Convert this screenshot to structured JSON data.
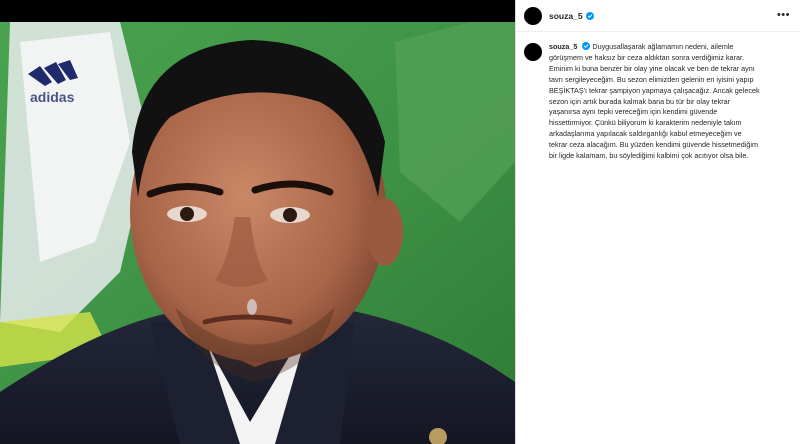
{
  "post": {
    "username": "souza_5",
    "verified": true,
    "more_icon": "more-horizontal-icon",
    "verified_icon": "verified-badge-icon",
    "caption": "Duygusallaşarak ağlamamın nedeni, ailemle\ngörüşmem ve haksız bir ceza aldıktan sonra verdiğimiz karar.\nEminim ki buna benzer bir olay yine olacak ve ben de tekrar aynı\ntavrı sergileyeceğim. Bu sezon elimizden gelenin en iyisini yapıp\nBEŞİKTAŞ'ı tekrar şampiyon yapmaya çalışacağız. Ancak gelecek\nsezon için artık burada kalmak bana bu tür bir olay tekrar\nyaşanırsa aynı tepki vereceğim için kendimi güvende\nhissettirmiyor. Çünkü biliyorum ki karakterim nedeniyle takım\narkadaşlarıma yapılacak saldırganlığı kabul etmeyeceğim ve\ntekrar ceza alacağım. Bu yüzden kendimi güvende hissetmediğim\nbir ligde kalamam, bu söylediğimi kalbimi çok acıtıyor olsa bile."
  },
  "colors": {
    "verified_blue": "#0095f6",
    "text": "#262626",
    "pitch_green": "#3f9a45"
  }
}
